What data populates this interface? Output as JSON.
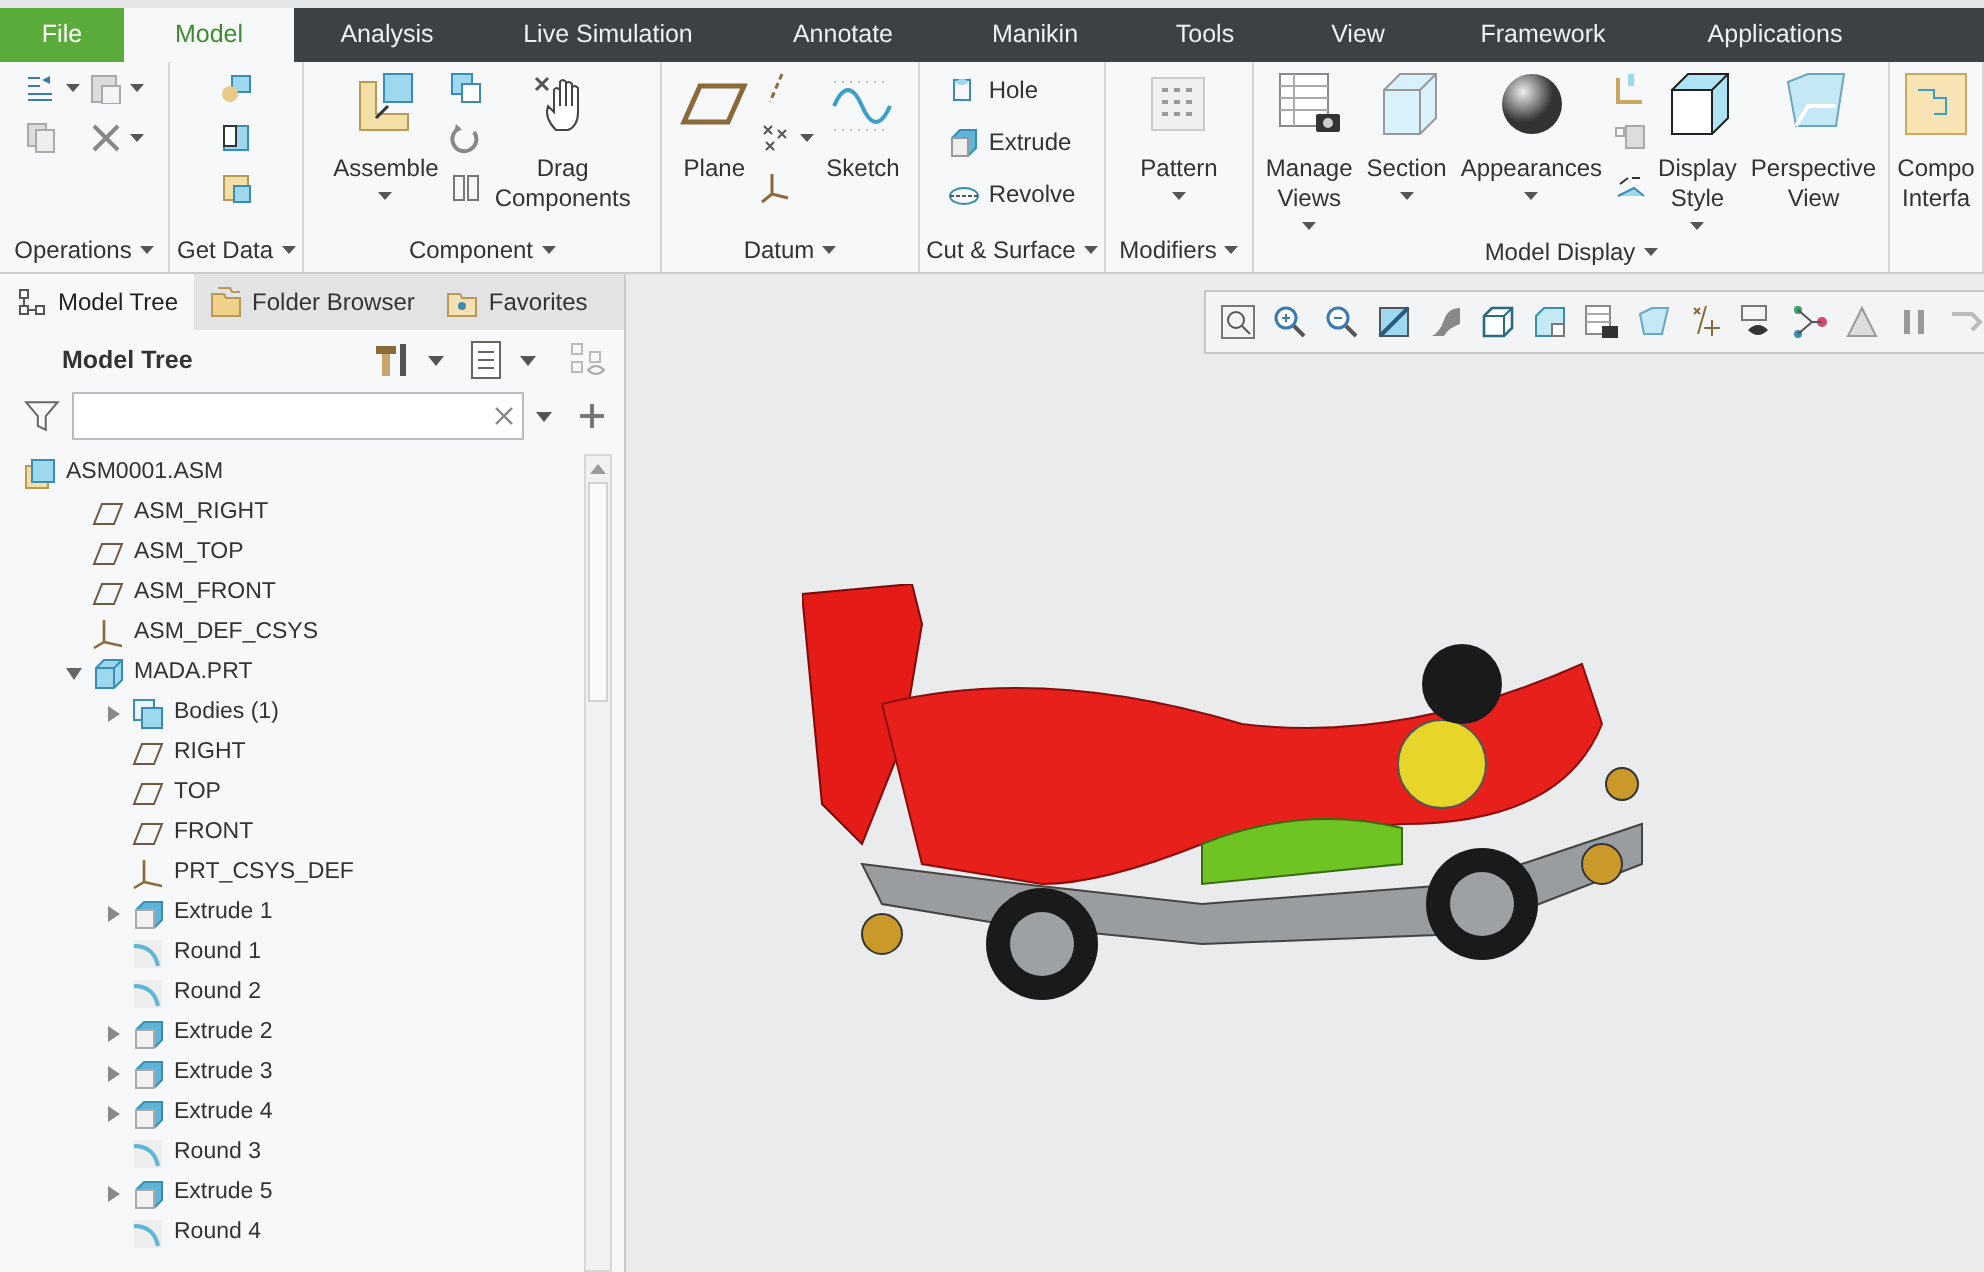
{
  "menu_tabs": [
    {
      "label": "File",
      "kind": "file",
      "selected": false
    },
    {
      "label": "Model",
      "kind": "tab",
      "selected": true
    },
    {
      "label": "Analysis",
      "kind": "tab",
      "selected": false
    },
    {
      "label": "Live Simulation",
      "kind": "tab",
      "selected": false
    },
    {
      "label": "Annotate",
      "kind": "tab",
      "selected": false
    },
    {
      "label": "Manikin",
      "kind": "tab",
      "selected": false
    },
    {
      "label": "Tools",
      "kind": "tab",
      "selected": false
    },
    {
      "label": "View",
      "kind": "tab",
      "selected": false
    },
    {
      "label": "Framework",
      "kind": "tab",
      "selected": false
    },
    {
      "label": "Applications",
      "kind": "tab",
      "selected": false
    }
  ],
  "ribbon_groups": [
    {
      "label": "Operations",
      "items": [
        {
          "kind": "stack",
          "items": [
            {
              "menu": true
            },
            {
              "menu": false
            }
          ]
        },
        {
          "kind": "stack",
          "items": [
            {
              "menu": true
            },
            {
              "menu": true
            }
          ]
        }
      ]
    },
    {
      "label": "Get Data",
      "items": [
        {
          "kind": "stack",
          "items": [
            {
              "menu": false
            },
            {
              "menu": false
            },
            {
              "menu": false
            }
          ]
        }
      ]
    },
    {
      "label": "Component",
      "items": [
        {
          "kind": "large",
          "label": "Assemble",
          "menu": true
        },
        {
          "kind": "stack",
          "items": [
            {
              "menu": false
            },
            {
              "menu": false
            },
            {
              "menu": false
            }
          ]
        },
        {
          "kind": "large",
          "label": "Drag Components",
          "menu": false
        }
      ]
    },
    {
      "label": "Datum",
      "items": [
        {
          "kind": "large",
          "label": "Plane",
          "menu": false
        },
        {
          "kind": "stack",
          "items": [
            {
              "menu": false
            },
            {
              "menu": true
            },
            {
              "menu": false
            }
          ]
        },
        {
          "kind": "large",
          "label": "Sketch",
          "menu": false
        }
      ]
    },
    {
      "label": "Cut & Surface",
      "items": [
        {
          "kind": "list",
          "items": [
            "Hole",
            "Extrude",
            "Revolve"
          ]
        }
      ]
    },
    {
      "label": "Modifiers",
      "items": [
        {
          "kind": "large",
          "label": "Pattern",
          "menu": true
        }
      ]
    },
    {
      "label": "Model Display",
      "items": [
        {
          "kind": "large",
          "label": "Manage Views",
          "menu": true
        },
        {
          "kind": "large",
          "label": "Section",
          "menu": true
        },
        {
          "kind": "large",
          "label": "Appearances",
          "menu": true
        },
        {
          "kind": "stack",
          "items": [
            {
              "menu": false
            },
            {
              "menu": false
            },
            {
              "menu": false
            }
          ]
        },
        {
          "kind": "large",
          "label": "Display Style",
          "menu": true
        },
        {
          "kind": "large",
          "label": "Perspective View",
          "menu": false
        }
      ]
    },
    {
      "items": [
        {
          "kind": "large",
          "label": "Compo Interfa",
          "menu": false
        }
      ]
    }
  ],
  "panel_tabs": [
    {
      "label": "Model Tree",
      "selected": true
    },
    {
      "label": "Folder Browser",
      "selected": false
    },
    {
      "label": "Favorites",
      "selected": false
    }
  ],
  "model_tree": {
    "title": "Model Tree",
    "nodes": [
      {
        "label": "ASM0001.ASM",
        "kind": "assembly",
        "children": [
          {
            "label": "ASM_RIGHT",
            "kind": "plane"
          },
          {
            "label": "ASM_TOP",
            "kind": "plane"
          },
          {
            "label": "ASM_FRONT",
            "kind": "plane"
          },
          {
            "label": "ASM_DEF_CSYS",
            "kind": "csys"
          },
          {
            "label": "MADA.PRT",
            "kind": "part",
            "expanded": true,
            "children": [
              {
                "label": "Bodies (1)",
                "kind": "bodies",
                "expanded": false
              },
              {
                "label": "RIGHT",
                "kind": "plane"
              },
              {
                "label": "TOP",
                "kind": "plane"
              },
              {
                "label": "FRONT",
                "kind": "plane"
              },
              {
                "label": "PRT_CSYS_DEF",
                "kind": "csys"
              },
              {
                "label": "Extrude 1",
                "kind": "extrude",
                "expanded": false
              },
              {
                "label": "Round 1",
                "kind": "round"
              },
              {
                "label": "Round 2",
                "kind": "round"
              },
              {
                "label": "Extrude 2",
                "kind": "extrude",
                "expanded": false
              },
              {
                "label": "Extrude 3",
                "kind": "extrude",
                "expanded": false
              },
              {
                "label": "Extrude 4",
                "kind": "extrude",
                "expanded": false
              },
              {
                "label": "Round 3",
                "kind": "round"
              },
              {
                "label": "Extrude 5",
                "kind": "extrude",
                "expanded": false
              },
              {
                "label": "Round 4",
                "kind": "round"
              }
            ]
          }
        ]
      }
    ]
  }
}
